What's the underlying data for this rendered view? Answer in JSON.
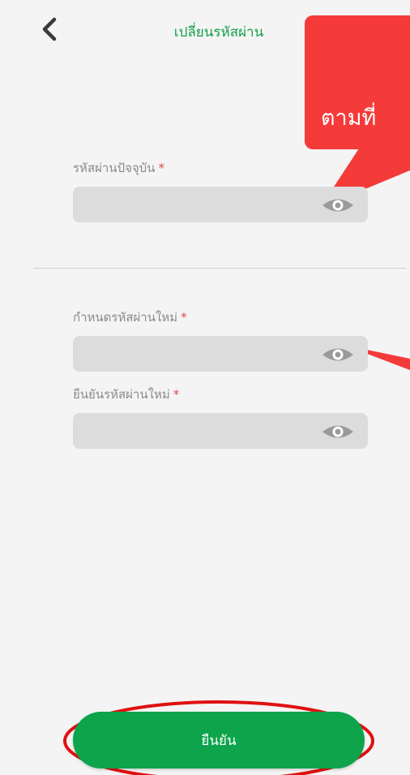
{
  "header": {
    "title": "เปลี่ยนรหัสผ่าน",
    "back_icon": "chevron-left-icon"
  },
  "annotation": {
    "callout_text": "ตามที่",
    "color": "#f53a3a"
  },
  "form": {
    "current_password": {
      "label": "รหัสผ่านปัจจุบัน",
      "required_mark": "*",
      "value": "",
      "placeholder": "",
      "icon": "eye-icon"
    },
    "new_password": {
      "label": "กำหนดรหัสผ่านใหม่",
      "required_mark": "*",
      "value": "",
      "placeholder": "",
      "icon": "eye-icon"
    },
    "confirm_password": {
      "label": "ยืนยันรหัสผ่านใหม่",
      "required_mark": "*",
      "value": "",
      "placeholder": "",
      "icon": "eye-icon"
    }
  },
  "submit": {
    "label": "ยืนยัน"
  },
  "colors": {
    "accent": "#14a04a",
    "button": "#0ea44b",
    "field_bg": "#dcdcdc",
    "page_bg": "#f4f4f4",
    "required": "#e04848"
  }
}
